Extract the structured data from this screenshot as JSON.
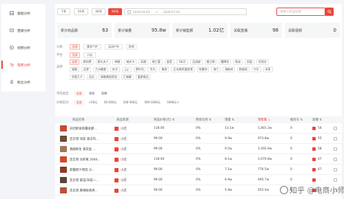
{
  "sidebar": {
    "items": [
      {
        "label": "基础分析",
        "icon": "chart-icon",
        "active": false
      },
      {
        "label": "直播分析",
        "icon": "live-icon",
        "active": false
      },
      {
        "label": "视频分析",
        "icon": "video-icon",
        "active": false
      },
      {
        "label": "电商分析",
        "icon": "cart-icon",
        "active": true
      },
      {
        "label": "粉丝分析",
        "icon": "fans-icon",
        "active": false
      }
    ]
  },
  "toolbar": {
    "ranges": [
      "7天",
      "15天",
      "30天",
      "90天"
    ],
    "active_range": "90天",
    "date_start": "2020-04-03",
    "date_end": "2020-07-01",
    "search_placeholder": "请输入商品标题"
  },
  "stats": [
    {
      "label": "累计商品数",
      "value": "63"
    },
    {
      "label": "累计销量",
      "value": "95.8w"
    },
    {
      "label": "累计销售额",
      "value": "1.02亿"
    },
    {
      "label": "关联直播",
      "value": "98"
    },
    {
      "label": "关联视频",
      "value": "0"
    }
  ],
  "filters": {
    "category_label": "分类",
    "categories": [
      "全部",
      "美妆个护",
      "运动户外",
      "其他"
    ],
    "platform_label": "平台",
    "platforms": [
      "全部",
      "小店"
    ],
    "brand_label": "品牌",
    "brands_row1": [
      "全部",
      "欧珀莱",
      "蔚头夫人",
      "韩雅",
      "威夫卡",
      "英雅",
      "格兰富",
      "晶莹",
      "Gb贝",
      "品迪缇",
      "植之物",
      "魔羯花",
      "高迪",
      "凯盈",
      "优丽谷"
    ],
    "brands_row2": [
      "瑞隆",
      "远梦",
      "兰州雅睿",
      "玖方",
      "CV",
      "德尔玛",
      "华为",
      "象群",
      "石岛朗风健身馆",
      "哈雅的",
      "海兰",
      "瑞蚨祥",
      "欧缇丽",
      "兴乐",
      "米家"
    ],
    "brands_row3": [
      "孕婴王子",
      "品谷",
      "瑞隆酱园家居",
      "汇福康",
      "富豪铸品"
    ],
    "source_label": "带货类型",
    "sources": [
      "全部",
      "视频",
      "直播"
    ],
    "price_label": "价格区间",
    "prices": [
      "全部",
      "<50元",
      "50-100元",
      "100-500元",
      "500-1000元",
      "1000元+"
    ]
  },
  "table": {
    "headers": [
      "商品名称",
      "商品来源",
      "商品价格(元)",
      "佣金比例",
      "销量",
      "销售额",
      "推荐号",
      "直播"
    ],
    "sorted_column": "销售额",
    "rows": [
      {
        "name": "开团即食南疆发酵...",
        "source": "小店",
        "price": "138.00",
        "commission": "0%",
        "sales": "13.1w",
        "revenue": "1,801.3w",
        "rec": "0",
        "live": "54",
        "color": "#c94b35"
      },
      {
        "name": "连云港 海苔 速冻的...",
        "source": "小店",
        "price": "99.00",
        "commission": "0%",
        "sales": "9.9w",
        "revenue": "973.8w",
        "rec": "0",
        "live": "55",
        "color": "#6e4b3a"
      },
      {
        "name": "香酥鲜生 黄花鱼 ...",
        "source": "小店",
        "price": "99.00",
        "commission": "0%",
        "sales": "9.5w",
        "revenue": "1,502.9w",
        "rec": "0",
        "live": "58",
        "color": "#a0775a"
      },
      {
        "name": "连云港 龙虾尾 2000...",
        "source": "小店",
        "price": "138.00",
        "commission": "0%",
        "sales": "8.1w",
        "revenue": "1,070.8w",
        "rec": "0",
        "live": "47",
        "color": "#d04a2e"
      },
      {
        "name": "新疆原汁烤肉 沙...",
        "source": "小店",
        "price": "99.00",
        "commission": "0%",
        "sales": "7.1w",
        "revenue": "776.5w",
        "rec": "0",
        "live": "47",
        "color": "#8a3b2c"
      },
      {
        "name": "连云港 紫菜/海苔一...",
        "source": "小店",
        "price": "99.00",
        "commission": "0%",
        "sales": "6.9w",
        "revenue": "695.7w",
        "rec": "0",
        "live": "...",
        "color": "#5a4438"
      },
      {
        "name": "连云港 麻辣鲜香烤...",
        "source": "小店",
        "price": "99.00",
        "commission": "0%",
        "sales": "5.9w",
        "revenue": "655.4w",
        "rec": "0",
        "live": "...",
        "color": "#b5553a"
      }
    ]
  },
  "watermark": "知乎 @电商小师妹er",
  "colors": {
    "accent": "#e8473b"
  }
}
